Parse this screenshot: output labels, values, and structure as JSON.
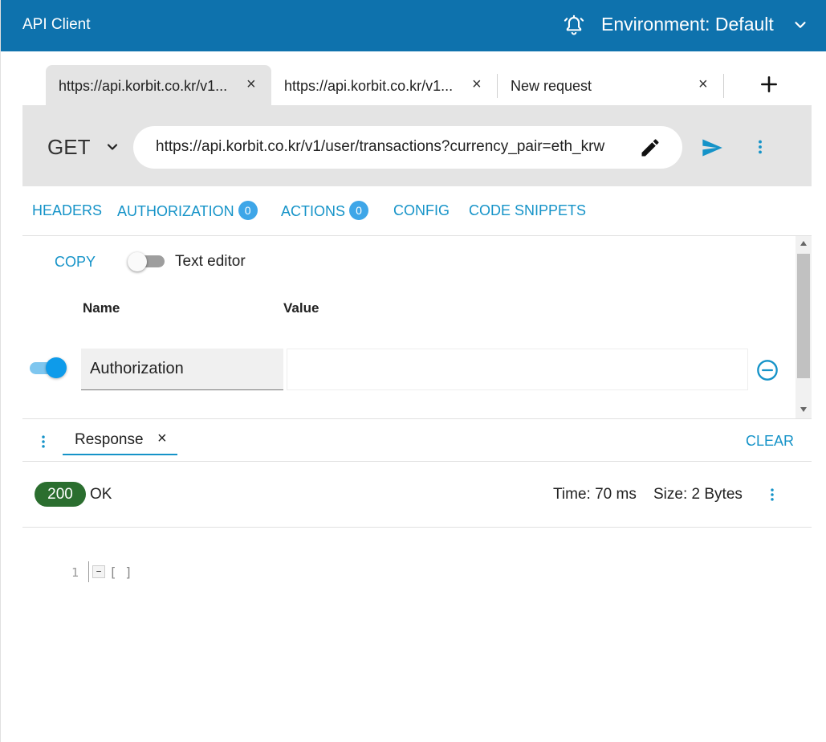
{
  "app": {
    "title": "API Client"
  },
  "environment": {
    "label": "Environment: Default"
  },
  "tabs": [
    {
      "label": "https://api.korbit.co.kr/v1...",
      "close": "×"
    },
    {
      "label": "https://api.korbit.co.kr/v1...",
      "close": "×"
    },
    {
      "label": "New request",
      "close": "×"
    }
  ],
  "request": {
    "method": "GET",
    "url": "https://api.korbit.co.kr/v1/user/transactions?currency_pair=eth_krw"
  },
  "subtabs": {
    "headers": "HEADERS",
    "authorization": "AUTHORIZATION",
    "authorization_count": "0",
    "actions": "ACTIONS",
    "actions_count": "0",
    "config": "CONFIG",
    "code_snippets": "CODE SNIPPETS"
  },
  "headers_panel": {
    "copy": "COPY",
    "text_editor": "Text editor",
    "text_editor_enabled": false,
    "col_name": "Name",
    "col_value": "Value",
    "rows": [
      {
        "enabled": true,
        "name": "Authorization",
        "value": ""
      }
    ]
  },
  "response": {
    "tab_label": "Response",
    "tab_close": "×",
    "clear": "CLEAR",
    "status_code": "200",
    "status_text": "OK",
    "time": "Time: 70 ms",
    "size": "Size: 2 Bytes",
    "code_line_number": "1",
    "code_fold": "−",
    "code_text": "[ ]"
  },
  "colors": {
    "topbar": "#0e72ad",
    "accent": "#1593c8",
    "badge": "#3ea6e8",
    "status_ok": "#2b6e2f"
  },
  "icons": {
    "bell": "bell-alarm-icon",
    "chevron": "chevron-down-icon",
    "add_tab": "plus-icon",
    "edit": "pencil-icon",
    "send": "send-icon",
    "more": "more-vert-icon",
    "remove": "remove-circle-icon"
  }
}
